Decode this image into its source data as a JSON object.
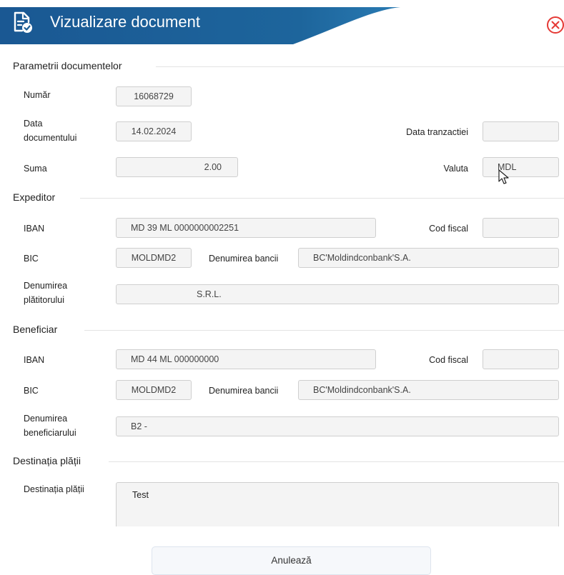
{
  "header": {
    "title": "Vizualizare document",
    "accent": "#1c5f98",
    "icons": {
      "document": "document-check-icon",
      "close": "close-circle-icon"
    }
  },
  "params": {
    "section_title": "Parametrii documentelor",
    "number_label": "Număr",
    "number_value": "16068729",
    "doc_date_label_1": "Data",
    "doc_date_label_2": "documentului",
    "doc_date_value": "14.02.2024",
    "tx_date_label": "Data tranzactiei",
    "tx_date_value": "",
    "sum_label": "Suma",
    "sum_value": "2.00",
    "currency_label": "Valuta",
    "currency_value": "MDL"
  },
  "sender": {
    "section_title": "Expeditor",
    "iban_label": "IBAN",
    "iban_value": "MD 39 ML 0000000002251",
    "fiscal_label": "Cod fiscal",
    "fiscal_value": "",
    "bic_label": "BIC",
    "bic_value": "MOLDMD2",
    "bank_label": "Denumirea bancii",
    "bank_value": "BC'Moldindconbank'S.A.",
    "payer_label_1": "Denumirea",
    "payer_label_2": "plătitorului",
    "payer_value": "S.R.L."
  },
  "beneficiary": {
    "section_title": "Beneficiar",
    "iban_label": "IBAN",
    "iban_value": "MD 44 ML 000000000",
    "fiscal_label": "Cod fiscal",
    "fiscal_value": "",
    "bic_label": "BIC",
    "bic_value": "MOLDMD2",
    "bank_label": "Denumirea bancii",
    "bank_value": "BC'Moldindconbank'S.A.",
    "name_label_1": "Denumirea",
    "name_label_2": "beneficiarului",
    "name_value": "B2 -"
  },
  "destination": {
    "section_title": "Destinația plății",
    "label": "Destinația plății",
    "value": "Test"
  },
  "footer": {
    "cancel_label": "Anulează"
  }
}
